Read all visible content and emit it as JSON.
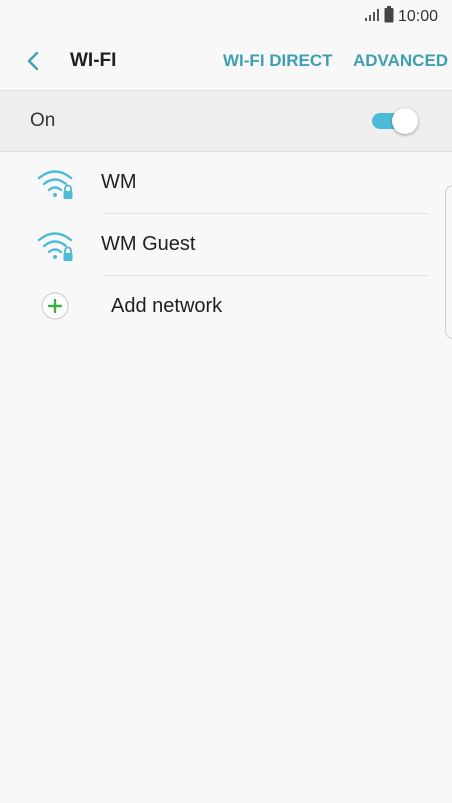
{
  "status_bar": {
    "time": "10:00",
    "signal_icon": "signal-icon",
    "battery_icon": "battery-icon"
  },
  "header": {
    "title": "WI-FI",
    "back_icon": "back-arrow-icon",
    "wifi_direct_label": "WI-FI DIRECT",
    "advanced_label": "ADVANCED"
  },
  "wifi_toggle": {
    "label": "On",
    "state": "on"
  },
  "networks": [
    {
      "name": "WM",
      "icon": "wifi-lock-icon"
    },
    {
      "name": "WM Guest",
      "icon": "wifi-lock-icon"
    }
  ],
  "add_network": {
    "label": "Add network",
    "icon": "add-circle-icon"
  },
  "colors": {
    "accent": "#3e9fb2",
    "wifi_icon": "#4cbbd8",
    "toggle_track": "#4cbbd8",
    "add_icon": "#3cb043",
    "background": "#f8f8f8",
    "toggle_row_bg": "#efefef"
  }
}
